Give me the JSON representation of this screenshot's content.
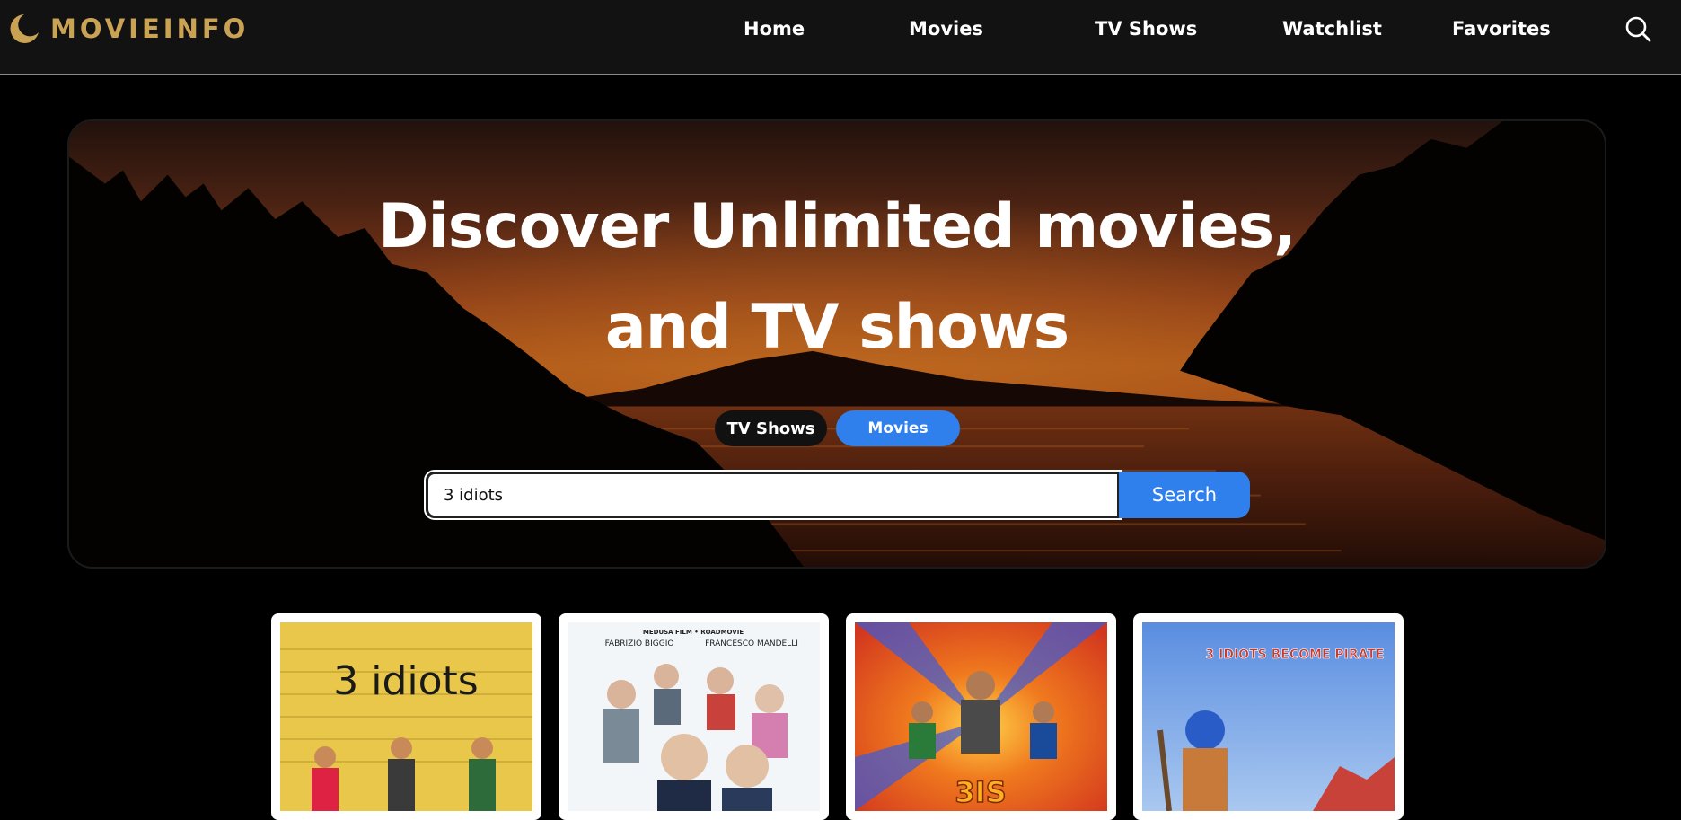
{
  "brand": {
    "name": "MOVIEINFO",
    "accent": "#c9a253"
  },
  "nav": {
    "links": [
      "Home",
      "Movies",
      "TV Shows",
      "Watchlist",
      "Favorites"
    ],
    "search_icon": "search-icon"
  },
  "hero": {
    "title_line1": "Discover Unlimited movies,",
    "title_line2": "and TV shows",
    "toggle_tv": "TV Shows",
    "toggle_movies": "Movies",
    "search_value": "3 idiots",
    "search_button": "Search",
    "accent": "#2f80ed"
  },
  "results": [
    {
      "poster_title": "3 idiots"
    },
    {
      "poster_credits_top": "MEDUSA FILM • ROADMOVIE",
      "poster_actor1": "FABRIZIO BIGGIO",
      "poster_actor2": "FRANCESCO MANDELLI"
    },
    {
      "poster_title": "3IS"
    },
    {
      "poster_title": "3 IDIOTS BECOME PIRATE"
    }
  ]
}
